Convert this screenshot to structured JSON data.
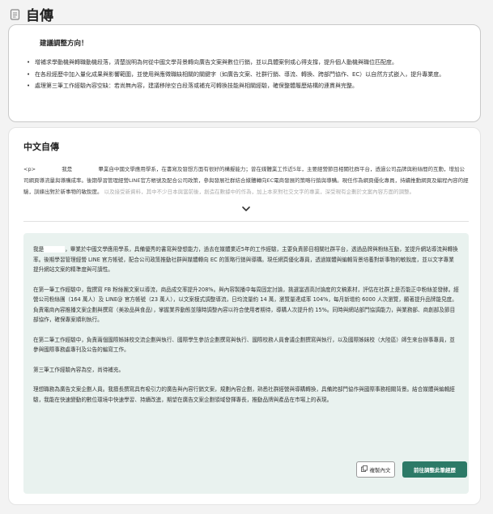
{
  "header": {
    "title": "自傳",
    "icon": "document-icon"
  },
  "advice": {
    "title": "建議調整方向！",
    "items": [
      "增補求學動機與轉職動機段落，清楚說明為何從中國文學背景轉向廣告文案與數位行銷，並以具體案例或心得支撐，提升個人動機與職位匹配度。",
      "在各段經歷中加入量化成果與影響範圍，並使用與應徵職缺相關的關鍵字（如廣告文案、社群行銷、導流、轉換、跨部門協作、EC）以自然方式嵌入，提升專業度。",
      "處理第三筆工作經驗內容空缺：若尚無內容，建議移除空白段落或補充可轉換技能與相關經驗，確保整體履歷結構的連貫與完整。"
    ]
  },
  "main": {
    "title": "中文自傳",
    "preview": {
      "tag": "<p>",
      "part1": "我是",
      "part2": "畢業自中國文學應用學系，在書寫及發想方面有很好的構擬能力；曾在媒體業工作近5年，主要經營節目相關社群平台，透過公司品牌與粉絲間的互動，增加公司網頁導流量與導購成率。後期學習管理經營LINE官方帳號及配合公司政策，參與發展社群結合媒體轉向EC電商發展的策略行銷與導購。現任作為網頁優化專員，持續推動網頁及編程內容的經驗，訓練出對於新事物的敏銳度。",
      "faded": "以及接受新資料，其中不少日本與當前後，創造在數據中的作為，加上本來對社交文字的專業，深受現有企劃於文案內容方面的調整。"
    },
    "body": {
      "p1_a": "我是",
      "p1_b": "，畢業於中國文學應用學系，具備優秀的書寫與發想能力，過去在媒體業近5年的工作經驗，主要負責節目相關社群平台，透過品牌與粉絲互動，並提升網站導流與轉換率。後期學習管理經營 LINE 官方帳號，配合公司政策推動社群與媒體轉向 EC 的策略行銷與導購。現任網頁優化專員，透過媒體與編輯背景培養對新事物的敏銳度，並以文字專業提升網站文案的精準度與可讀性。",
      "p2": "在第一筆工作經驗中，我撰寫 FB 粉絲團文案以導流，商品成交率提升208%。與內容製播中每周固定討論，挑選當週高討論度的文稿素材，評估在社群上是否能正中粉絲並發酵。經營公司粉絲團（164 萬人）及 LINE@ 官方帳號（23 萬人），以文案模式調整導流，日均流量約 14 萬，瀏覽量達成率 104%，每月新增約 6000 人次瀏覽，顯著提升品牌能見度。負責電商內容推播文案企劃與撰寫（美妝品與食品），掌握業界動態並隨時調整內容以符合使用者期待，導購人次提升約 15%。同時與網站部門協調能力，與業務部、商創部及節目部協作，確保專案順利執行。",
      "p3": "在第二筆工作經驗中，負責兩個國際姊妹校交流企劃與執行、國際學生參訪企劃撰寫與執行、國際校務人員會議企劃撰寫與執行，以及國際姊妹校（大陸區）師生來台辦事專員，並參與國際事務處專刊及公告的編寫工作。",
      "p4": "第三筆工作經驗內容為空，尚待補充。",
      "p5": "理想職務為廣告文案企劃人員。我擅長撰寫具有吸引力的廣告與內容行銷文案，規劃內容企劃，熟悉社群經營與導購轉換，具備跨部門協作與國際事務相關背景。結合媒體與編輯經驗，我能在快速變動的數位環境中快速學習、持續改進，期望在廣告文案企劃領域發揮專長，推動品牌與產品在市場上的表現。"
    },
    "copy_button": "複製內文",
    "go_button": "前往調整此筆經歷"
  },
  "colors": {
    "accent": "#2c7a67",
    "panel_bg": "#e9f2ef"
  }
}
